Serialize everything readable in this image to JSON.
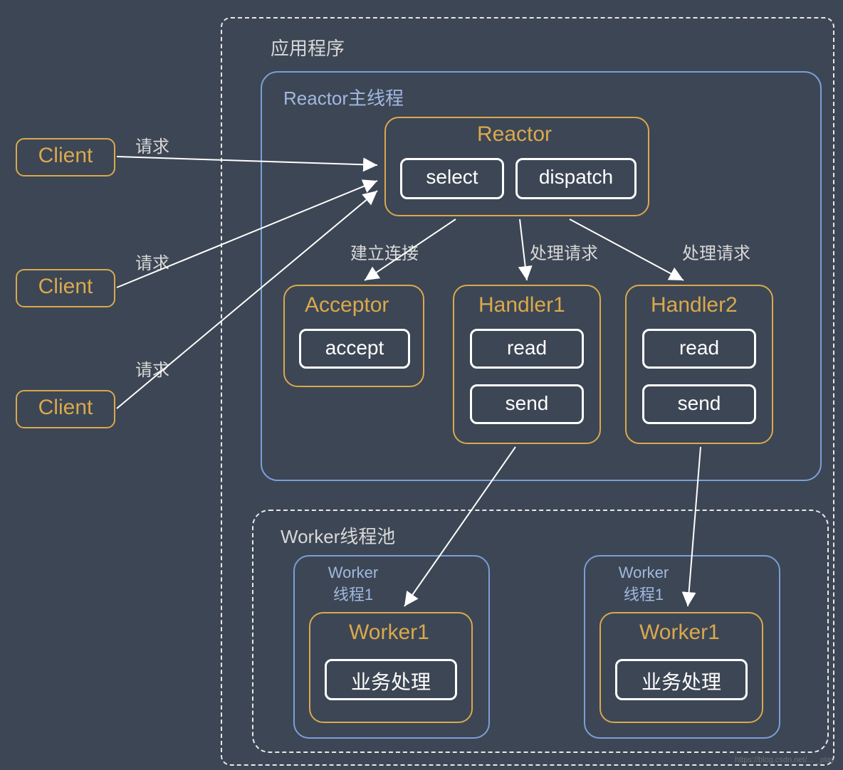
{
  "app": {
    "title": "应用程序"
  },
  "clients": [
    {
      "label": "Client",
      "edge_label": "请求"
    },
    {
      "label": "Client",
      "edge_label": "请求"
    },
    {
      "label": "Client",
      "edge_label": "请求"
    }
  ],
  "reactor_thread": {
    "title": "Reactor主线程",
    "reactor": {
      "title": "Reactor",
      "select": "select",
      "dispatch": "dispatch"
    },
    "edges": {
      "establish": "建立连接",
      "process1": "处理请求",
      "process2": "处理请求"
    },
    "acceptor": {
      "title": "Acceptor",
      "accept": "accept"
    },
    "handler1": {
      "title": "Handler1",
      "read": "read",
      "send": "send"
    },
    "handler2": {
      "title": "Handler2",
      "read": "read",
      "send": "send"
    }
  },
  "worker_pool": {
    "title": "Worker线程池",
    "worker1": {
      "thread_label": "Worker\n线程1",
      "name": "Worker1",
      "biz": "业务处理"
    },
    "worker2": {
      "thread_label": "Worker\n线程1",
      "name": "Worker1",
      "biz": "业务处理"
    }
  },
  "watermark": "https://blog.csdn.net/... _play"
}
